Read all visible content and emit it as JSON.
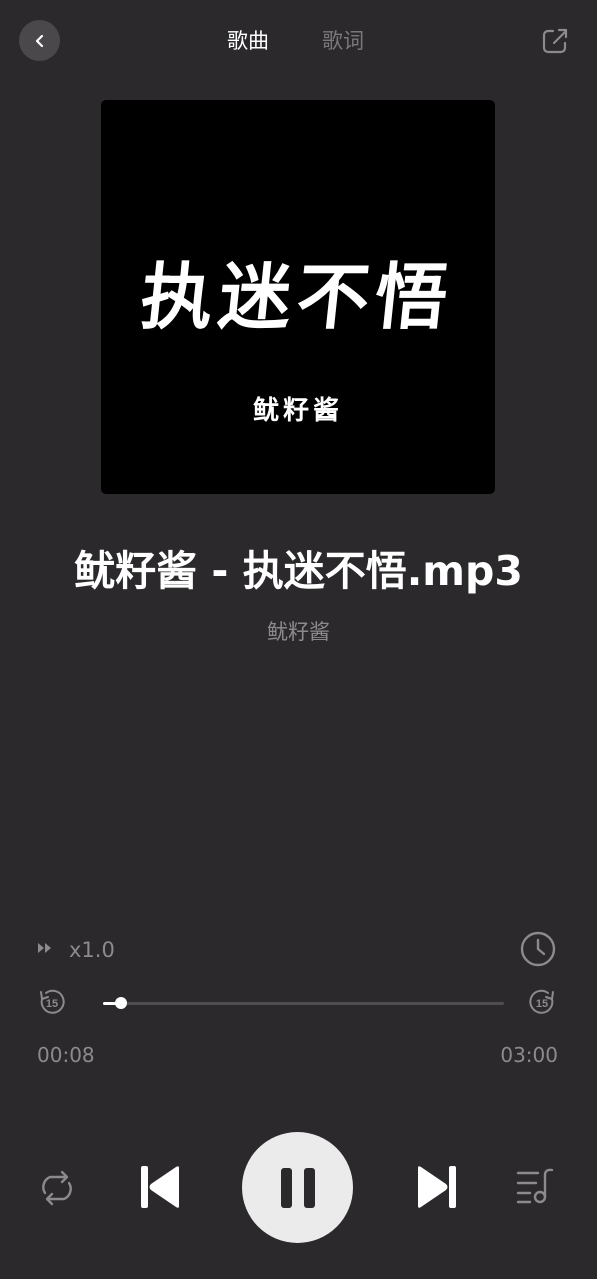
{
  "header": {
    "tabs": [
      {
        "label": "歌曲",
        "active": true
      },
      {
        "label": "歌词",
        "active": false
      }
    ],
    "back_icon": "chevron-left-icon",
    "share_icon": "share-external-icon"
  },
  "cover": {
    "title_text": "执迷不悟",
    "artist_text": "鱿籽酱"
  },
  "song": {
    "title": "鱿籽酱 - 执迷不悟.mp3",
    "artist": "鱿籽酱"
  },
  "playback": {
    "speed_label": "x1.0",
    "current_time": "00:08",
    "total_time": "03:00",
    "progress": 0.044,
    "skip_back_label": "15",
    "skip_forward_label": "15",
    "is_playing": true
  },
  "colors": {
    "background": "#2b292c",
    "muted_text": "#8c8a8d",
    "play_button": "#ecebec"
  }
}
